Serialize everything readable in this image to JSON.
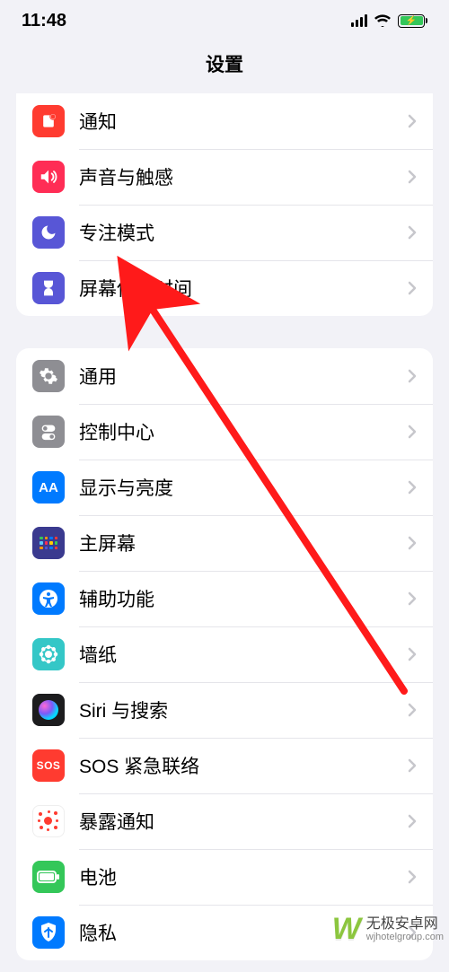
{
  "status": {
    "time": "11:48"
  },
  "header": {
    "title": "设置"
  },
  "group1": {
    "items": [
      {
        "label": "通知"
      },
      {
        "label": "声音与触感"
      },
      {
        "label": "专注模式"
      },
      {
        "label": "屏幕使用时间"
      }
    ]
  },
  "group2": {
    "items": [
      {
        "label": "通用"
      },
      {
        "label": "控制中心"
      },
      {
        "label": "显示与亮度",
        "icon_text": "AA"
      },
      {
        "label": "主屏幕"
      },
      {
        "label": "辅助功能"
      },
      {
        "label": "墙纸"
      },
      {
        "label": "Siri 与搜索"
      },
      {
        "label": "SOS 紧急联络",
        "icon_text": "SOS"
      },
      {
        "label": "暴露通知"
      },
      {
        "label": "电池"
      },
      {
        "label": "隐私"
      }
    ]
  },
  "watermark": {
    "logo": "W",
    "title": "无极安卓网",
    "url": "wjhotelgroup.com"
  }
}
